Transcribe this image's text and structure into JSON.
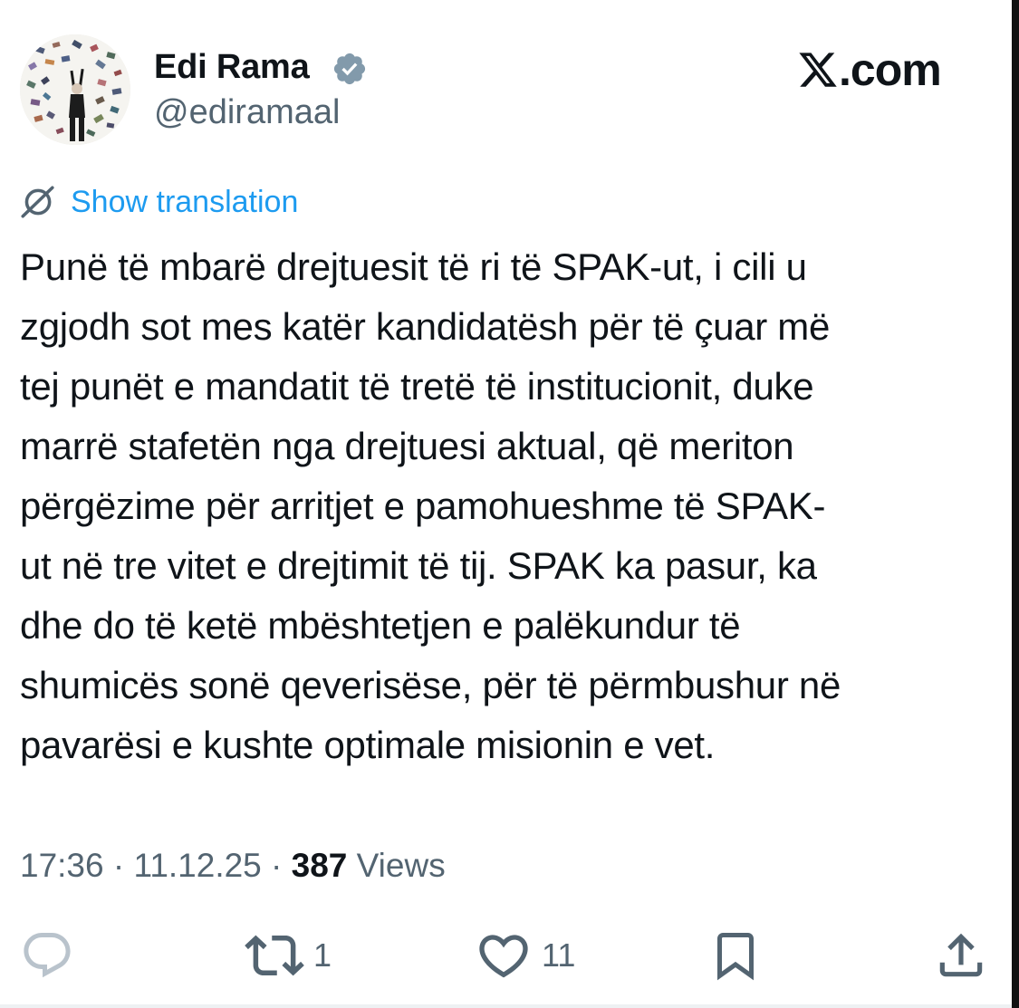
{
  "author": {
    "display_name": "Edi Rama",
    "handle": "@ediramaal",
    "verified": true
  },
  "brand": {
    "logo_text": ".com",
    "logo_icon": "x-logo-icon"
  },
  "translate": {
    "label": "Show translation",
    "icon": "translate-icon"
  },
  "tweet": {
    "text": "Punë të mbarë drejtuesit të ri të SPAK-ut, i cili u\nzgjodh sot mes katër kandidatësh për të çuar më\ntej punët e mandatit të tretë të institucionit, duke\nmarrë stafetën nga drejtuesi aktual, që meriton\npërgëzime për arritjet e pamohueshme të SPAK-\nut në tre vitet e drejtimit të tij. SPAK ka pasur, ka\ndhe do të ketë mbështetjen e palëkundur të\nshumicës sonë qeverisëse, për të përmbushur  në\npavarësi e kushte optimale misionin e vet."
  },
  "meta": {
    "time": "17:36",
    "separator": "·",
    "date": "11.12.25",
    "views_count": "387",
    "views_label": "Views"
  },
  "actions": {
    "reply": {
      "icon": "reply-icon",
      "count": ""
    },
    "retweet": {
      "icon": "retweet-icon",
      "count": "1"
    },
    "like": {
      "icon": "heart-icon",
      "count": "11"
    },
    "bookmark": {
      "icon": "bookmark-icon"
    },
    "share": {
      "icon": "share-icon"
    }
  },
  "colors": {
    "text": "#0f1419",
    "secondary": "#536471",
    "link": "#1d9bf0",
    "verified": "#829aab"
  }
}
